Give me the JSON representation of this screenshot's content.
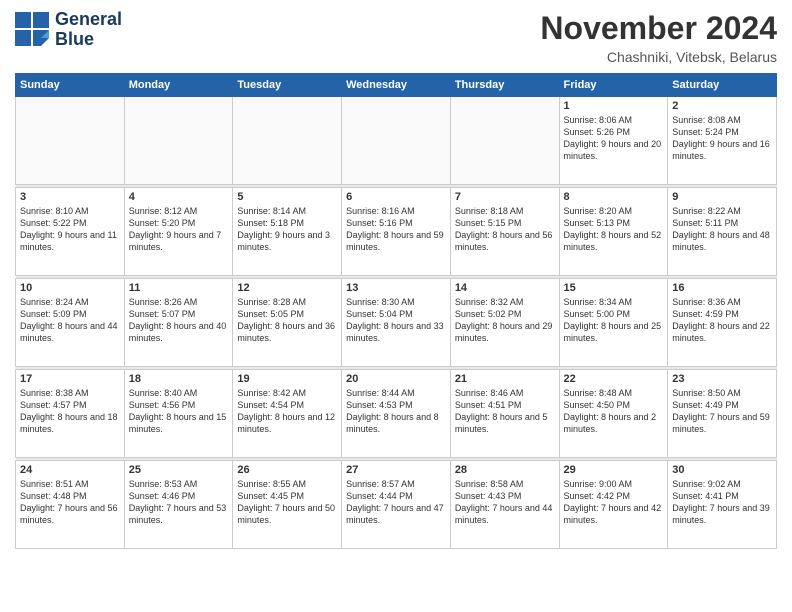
{
  "header": {
    "logo_line1": "General",
    "logo_line2": "Blue",
    "month_title": "November 2024",
    "location": "Chashniki, Vitebsk, Belarus"
  },
  "calendar": {
    "days_of_week": [
      "Sunday",
      "Monday",
      "Tuesday",
      "Wednesday",
      "Thursday",
      "Friday",
      "Saturday"
    ],
    "weeks": [
      [
        {
          "day": "",
          "info": ""
        },
        {
          "day": "",
          "info": ""
        },
        {
          "day": "",
          "info": ""
        },
        {
          "day": "",
          "info": ""
        },
        {
          "day": "",
          "info": ""
        },
        {
          "day": "1",
          "info": "Sunrise: 8:06 AM\nSunset: 5:26 PM\nDaylight: 9 hours\nand 20 minutes."
        },
        {
          "day": "2",
          "info": "Sunrise: 8:08 AM\nSunset: 5:24 PM\nDaylight: 9 hours\nand 16 minutes."
        }
      ],
      [
        {
          "day": "3",
          "info": "Sunrise: 8:10 AM\nSunset: 5:22 PM\nDaylight: 9 hours\nand 11 minutes."
        },
        {
          "day": "4",
          "info": "Sunrise: 8:12 AM\nSunset: 5:20 PM\nDaylight: 9 hours\nand 7 minutes."
        },
        {
          "day": "5",
          "info": "Sunrise: 8:14 AM\nSunset: 5:18 PM\nDaylight: 9 hours\nand 3 minutes."
        },
        {
          "day": "6",
          "info": "Sunrise: 8:16 AM\nSunset: 5:16 PM\nDaylight: 8 hours\nand 59 minutes."
        },
        {
          "day": "7",
          "info": "Sunrise: 8:18 AM\nSunset: 5:15 PM\nDaylight: 8 hours\nand 56 minutes."
        },
        {
          "day": "8",
          "info": "Sunrise: 8:20 AM\nSunset: 5:13 PM\nDaylight: 8 hours\nand 52 minutes."
        },
        {
          "day": "9",
          "info": "Sunrise: 8:22 AM\nSunset: 5:11 PM\nDaylight: 8 hours\nand 48 minutes."
        }
      ],
      [
        {
          "day": "10",
          "info": "Sunrise: 8:24 AM\nSunset: 5:09 PM\nDaylight: 8 hours\nand 44 minutes."
        },
        {
          "day": "11",
          "info": "Sunrise: 8:26 AM\nSunset: 5:07 PM\nDaylight: 8 hours\nand 40 minutes."
        },
        {
          "day": "12",
          "info": "Sunrise: 8:28 AM\nSunset: 5:05 PM\nDaylight: 8 hours\nand 36 minutes."
        },
        {
          "day": "13",
          "info": "Sunrise: 8:30 AM\nSunset: 5:04 PM\nDaylight: 8 hours\nand 33 minutes."
        },
        {
          "day": "14",
          "info": "Sunrise: 8:32 AM\nSunset: 5:02 PM\nDaylight: 8 hours\nand 29 minutes."
        },
        {
          "day": "15",
          "info": "Sunrise: 8:34 AM\nSunset: 5:00 PM\nDaylight: 8 hours\nand 25 minutes."
        },
        {
          "day": "16",
          "info": "Sunrise: 8:36 AM\nSunset: 4:59 PM\nDaylight: 8 hours\nand 22 minutes."
        }
      ],
      [
        {
          "day": "17",
          "info": "Sunrise: 8:38 AM\nSunset: 4:57 PM\nDaylight: 8 hours\nand 18 minutes."
        },
        {
          "day": "18",
          "info": "Sunrise: 8:40 AM\nSunset: 4:56 PM\nDaylight: 8 hours\nand 15 minutes."
        },
        {
          "day": "19",
          "info": "Sunrise: 8:42 AM\nSunset: 4:54 PM\nDaylight: 8 hours\nand 12 minutes."
        },
        {
          "day": "20",
          "info": "Sunrise: 8:44 AM\nSunset: 4:53 PM\nDaylight: 8 hours\nand 8 minutes."
        },
        {
          "day": "21",
          "info": "Sunrise: 8:46 AM\nSunset: 4:51 PM\nDaylight: 8 hours\nand 5 minutes."
        },
        {
          "day": "22",
          "info": "Sunrise: 8:48 AM\nSunset: 4:50 PM\nDaylight: 8 hours\nand 2 minutes."
        },
        {
          "day": "23",
          "info": "Sunrise: 8:50 AM\nSunset: 4:49 PM\nDaylight: 7 hours\nand 59 minutes."
        }
      ],
      [
        {
          "day": "24",
          "info": "Sunrise: 8:51 AM\nSunset: 4:48 PM\nDaylight: 7 hours\nand 56 minutes."
        },
        {
          "day": "25",
          "info": "Sunrise: 8:53 AM\nSunset: 4:46 PM\nDaylight: 7 hours\nand 53 minutes."
        },
        {
          "day": "26",
          "info": "Sunrise: 8:55 AM\nSunset: 4:45 PM\nDaylight: 7 hours\nand 50 minutes."
        },
        {
          "day": "27",
          "info": "Sunrise: 8:57 AM\nSunset: 4:44 PM\nDaylight: 7 hours\nand 47 minutes."
        },
        {
          "day": "28",
          "info": "Sunrise: 8:58 AM\nSunset: 4:43 PM\nDaylight: 7 hours\nand 44 minutes."
        },
        {
          "day": "29",
          "info": "Sunrise: 9:00 AM\nSunset: 4:42 PM\nDaylight: 7 hours\nand 42 minutes."
        },
        {
          "day": "30",
          "info": "Sunrise: 9:02 AM\nSunset: 4:41 PM\nDaylight: 7 hours\nand 39 minutes."
        }
      ]
    ]
  }
}
